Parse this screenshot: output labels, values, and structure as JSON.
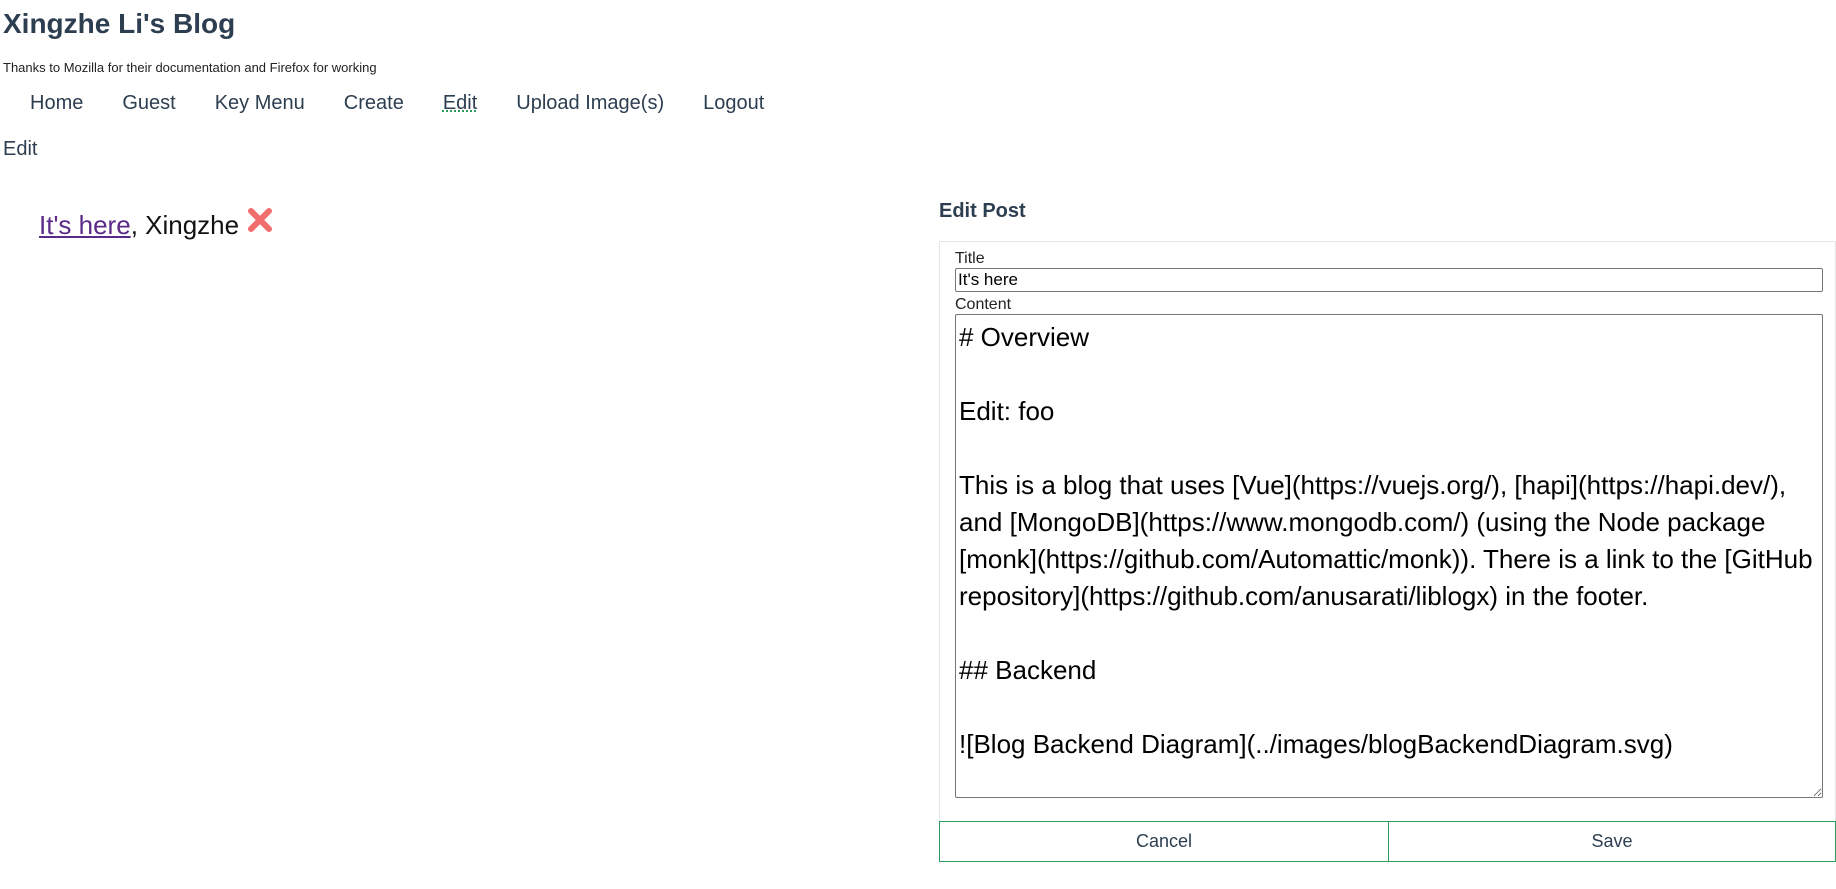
{
  "header": {
    "title": "Xingzhe Li's Blog",
    "subtitle": "Thanks to Mozilla for their documentation and Firefox for working"
  },
  "nav": {
    "items": [
      {
        "label": "Home"
      },
      {
        "label": "Guest"
      },
      {
        "label": "Key Menu"
      },
      {
        "label": "Create"
      },
      {
        "label": "Edit",
        "active": true
      },
      {
        "label": "Upload Image(s)"
      },
      {
        "label": "Logout"
      }
    ]
  },
  "page": {
    "heading": "Edit"
  },
  "posts": [
    {
      "title": "It's here",
      "separator": ", ",
      "author": "Xingzhe",
      "delete_icon": "close-x-icon"
    }
  ],
  "edit_form": {
    "heading": "Edit Post",
    "title_label": "Title",
    "title_value": "It's here",
    "content_label": "Content",
    "content_value": "# Overview\n\nEdit: foo\n\nThis is a blog that uses [Vue](https://vuejs.org/), [hapi](https://hapi.dev/), and [MongoDB](https://www.mongodb.com/) (using the Node package [monk](https://github.com/Automattic/monk)). There is a link to the [GitHub repository](https://github.com/anusarati/liblogx) in the footer.\n\n## Backend\n\n![Blog Backend Diagram](../images/blogBackendDiagram.svg)",
    "cancel_label": "Cancel",
    "save_label": "Save"
  },
  "colors": {
    "text": "#2c3e50",
    "link_visited": "#5b2a86",
    "delete_icon": "#f26d6d",
    "button_border": "#2a9d5c"
  }
}
